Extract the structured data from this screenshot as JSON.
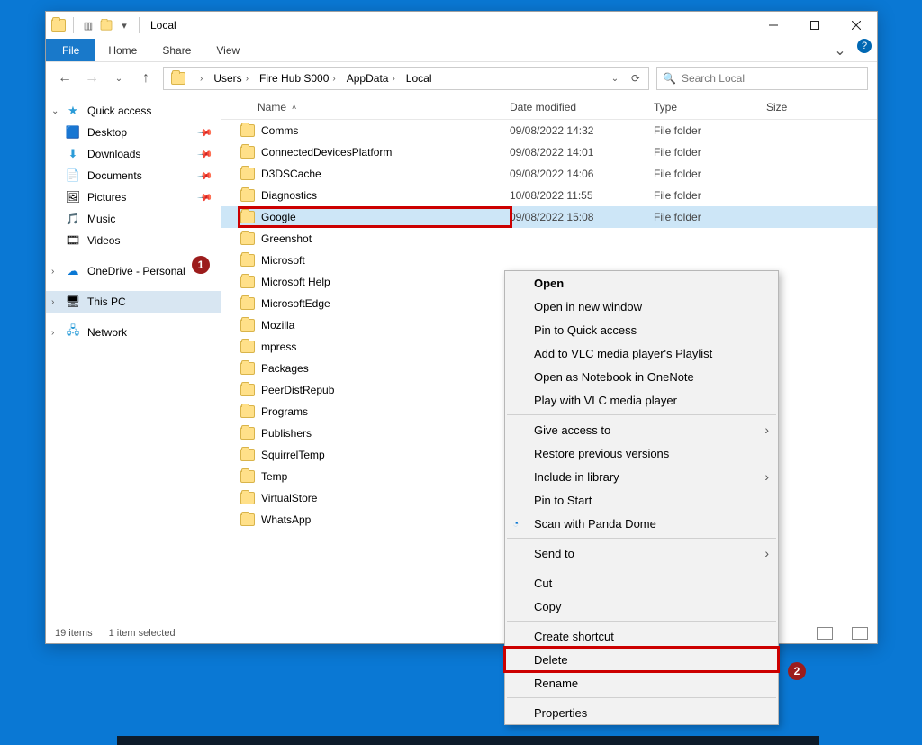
{
  "window": {
    "title": "Local"
  },
  "ribbon": {
    "file": "File",
    "tabs": [
      "Home",
      "Share",
      "View"
    ]
  },
  "breadcrumbs": [
    "Users",
    "Fire Hub S000",
    "AppData",
    "Local"
  ],
  "search_placeholder": "Search Local",
  "nav": {
    "quick_access": "Quick access",
    "quick_items": [
      {
        "label": "Desktop",
        "icon": "🟦",
        "pin": true
      },
      {
        "label": "Downloads",
        "icon": "⬇",
        "pin": true
      },
      {
        "label": "Documents",
        "icon": "📄",
        "pin": true
      },
      {
        "label": "Pictures",
        "icon": "🖼",
        "pin": true
      },
      {
        "label": "Music",
        "icon": "🎵",
        "pin": false
      },
      {
        "label": "Videos",
        "icon": "🎞",
        "pin": false
      }
    ],
    "onedrive": "OneDrive - Personal",
    "this_pc": "This PC",
    "network": "Network"
  },
  "columns": {
    "name": "Name",
    "date": "Date modified",
    "type": "Type",
    "size": "Size"
  },
  "files": [
    {
      "name": "Comms",
      "date": "09/08/2022 14:32",
      "type": "File folder"
    },
    {
      "name": "ConnectedDevicesPlatform",
      "date": "09/08/2022 14:01",
      "type": "File folder"
    },
    {
      "name": "D3DSCache",
      "date": "09/08/2022 14:06",
      "type": "File folder"
    },
    {
      "name": "Diagnostics",
      "date": "10/08/2022 11:55",
      "type": "File folder"
    },
    {
      "name": "Google",
      "date": "09/08/2022 15:08",
      "type": "File folder",
      "selected": true
    },
    {
      "name": "Greenshot",
      "date": "",
      "type": ""
    },
    {
      "name": "Microsoft",
      "date": "",
      "type": ""
    },
    {
      "name": "Microsoft Help",
      "date": "",
      "type": ""
    },
    {
      "name": "MicrosoftEdge",
      "date": "",
      "type": ""
    },
    {
      "name": "Mozilla",
      "date": "",
      "type": ""
    },
    {
      "name": "mpress",
      "date": "",
      "type": ""
    },
    {
      "name": "Packages",
      "date": "",
      "type": ""
    },
    {
      "name": "PeerDistRepub",
      "date": "",
      "type": ""
    },
    {
      "name": "Programs",
      "date": "",
      "type": ""
    },
    {
      "name": "Publishers",
      "date": "",
      "type": ""
    },
    {
      "name": "SquirrelTemp",
      "date": "",
      "type": ""
    },
    {
      "name": "Temp",
      "date": "",
      "type": ""
    },
    {
      "name": "VirtualStore",
      "date": "",
      "type": ""
    },
    {
      "name": "WhatsApp",
      "date": "",
      "type": ""
    }
  ],
  "status": {
    "count": "19 items",
    "sel": "1 item selected"
  },
  "ctx": {
    "open": "Open",
    "open_new": "Open in new window",
    "pin_qa": "Pin to Quick access",
    "vlc_add": "Add to VLC media player's Playlist",
    "onenote": "Open as Notebook in OneNote",
    "vlc_play": "Play with VLC media player",
    "give_access": "Give access to",
    "restore": "Restore previous versions",
    "library": "Include in library",
    "pin_start": "Pin to Start",
    "panda": "Scan with Panda Dome",
    "send_to": "Send to",
    "cut": "Cut",
    "copy": "Copy",
    "shortcut": "Create shortcut",
    "delete": "Delete",
    "rename": "Rename",
    "properties": "Properties"
  },
  "annot": {
    "one": "1",
    "two": "2"
  }
}
